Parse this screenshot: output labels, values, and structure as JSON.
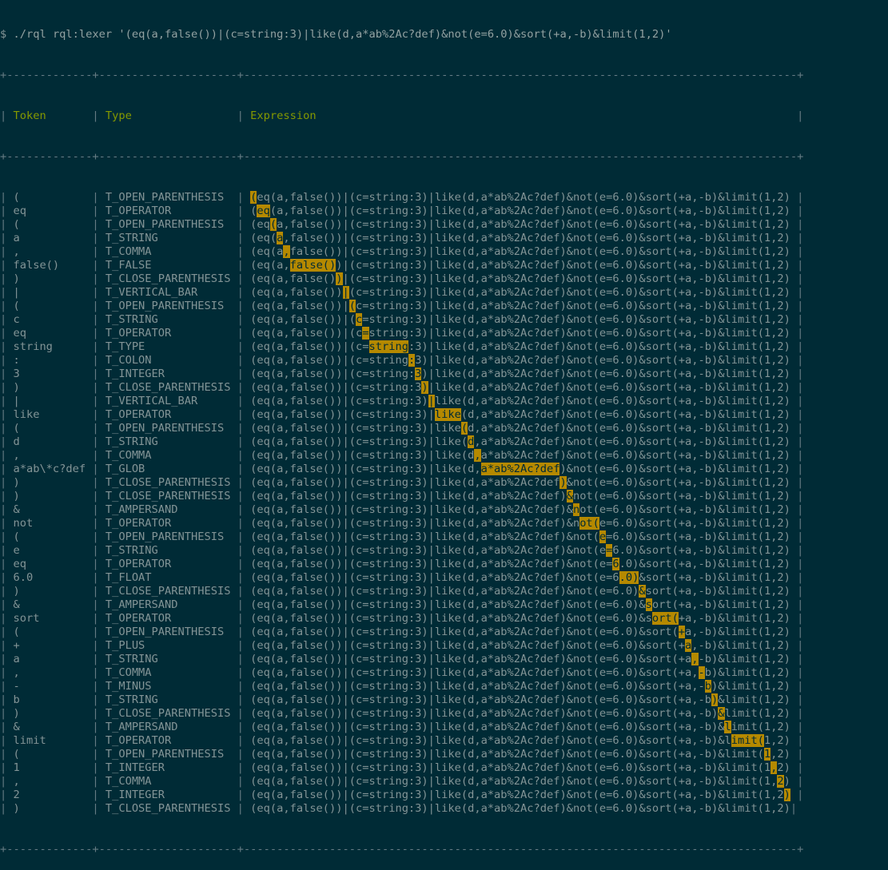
{
  "colors": {
    "background": "#002b36",
    "text": "#839496",
    "header": "#859900",
    "highlight_bg": "#b58900",
    "highlight_fg": "#002b36"
  },
  "prompt": "$",
  "command": "./rql rql:lexer '(eq(a,false())|(c=string:3)|like(d,a*ab%2Ac?def)&not(e=6.0)&sort(+a,-b)&limit(1,2)'",
  "expression": "(eq(a,false())|(c=string:3)|like(d,a*ab%2Ac?def)&not(e=6.0)&sort(+a,-b)&limit(1,2)",
  "headers": {
    "token": "Token",
    "type": "Type",
    "expression": "Expression"
  },
  "rows": [
    {
      "token": "(",
      "type": "T_OPEN_PARENTHESIS",
      "start": 0,
      "len": 1
    },
    {
      "token": "eq",
      "type": "T_OPERATOR",
      "start": 1,
      "len": 2
    },
    {
      "token": "(",
      "type": "T_OPEN_PARENTHESIS",
      "start": 3,
      "len": 1
    },
    {
      "token": "a",
      "type": "T_STRING",
      "start": 4,
      "len": 1
    },
    {
      "token": ",",
      "type": "T_COMMA",
      "start": 5,
      "len": 1
    },
    {
      "token": "false()",
      "type": "T_FALSE",
      "start": 6,
      "len": 7
    },
    {
      "token": ")",
      "type": "T_CLOSE_PARENTHESIS",
      "start": 13,
      "len": 1
    },
    {
      "token": "|",
      "type": "T_VERTICAL_BAR",
      "start": 14,
      "len": 1
    },
    {
      "token": "(",
      "type": "T_OPEN_PARENTHESIS",
      "start": 15,
      "len": 1
    },
    {
      "token": "c",
      "type": "T_STRING",
      "start": 16,
      "len": 1
    },
    {
      "token": "eq",
      "type": "T_OPERATOR",
      "start": 17,
      "len": 1
    },
    {
      "token": "string",
      "type": "T_TYPE",
      "start": 18,
      "len": 6
    },
    {
      "token": ":",
      "type": "T_COLON",
      "start": 24,
      "len": 1
    },
    {
      "token": "3",
      "type": "T_INTEGER",
      "start": 25,
      "len": 1
    },
    {
      "token": ")",
      "type": "T_CLOSE_PARENTHESIS",
      "start": 26,
      "len": 1
    },
    {
      "token": "|",
      "type": "T_VERTICAL_BAR",
      "start": 27,
      "len": 1
    },
    {
      "token": "like",
      "type": "T_OPERATOR",
      "start": 28,
      "len": 4
    },
    {
      "token": "(",
      "type": "T_OPEN_PARENTHESIS",
      "start": 32,
      "len": 1
    },
    {
      "token": "d",
      "type": "T_STRING",
      "start": 33,
      "len": 1
    },
    {
      "token": ",",
      "type": "T_COMMA",
      "start": 34,
      "len": 1
    },
    {
      "token": "a*ab\\*c?def",
      "type": "T_GLOB",
      "start": 35,
      "len": 12
    },
    {
      "token": ")",
      "type": "T_CLOSE_PARENTHESIS",
      "start": 47,
      "len": 1
    },
    {
      "token": ")",
      "type": "T_CLOSE_PARENTHESIS",
      "start": 48,
      "len": 1
    },
    {
      "token": "&",
      "type": "T_AMPERSAND",
      "start": 49,
      "len": 1
    },
    {
      "token": "not",
      "type": "T_OPERATOR",
      "start": 50,
      "len": 3
    },
    {
      "token": "(",
      "type": "T_OPEN_PARENTHESIS",
      "start": 53,
      "len": 1
    },
    {
      "token": "e",
      "type": "T_STRING",
      "start": 54,
      "len": 1
    },
    {
      "token": "eq",
      "type": "T_OPERATOR",
      "start": 55,
      "len": 1
    },
    {
      "token": "6.0",
      "type": "T_FLOAT",
      "start": 56,
      "len": 3
    },
    {
      "token": ")",
      "type": "T_CLOSE_PARENTHESIS",
      "start": 59,
      "len": 1
    },
    {
      "token": "&",
      "type": "T_AMPERSAND",
      "start": 60,
      "len": 1
    },
    {
      "token": "sort",
      "type": "T_OPERATOR",
      "start": 61,
      "len": 4
    },
    {
      "token": "(",
      "type": "T_OPEN_PARENTHESIS",
      "start": 65,
      "len": 1
    },
    {
      "token": "+",
      "type": "T_PLUS",
      "start": 66,
      "len": 1
    },
    {
      "token": "a",
      "type": "T_STRING",
      "start": 67,
      "len": 1
    },
    {
      "token": ",",
      "type": "T_COMMA",
      "start": 68,
      "len": 1
    },
    {
      "token": "-",
      "type": "T_MINUS",
      "start": 69,
      "len": 1
    },
    {
      "token": "b",
      "type": "T_STRING",
      "start": 70,
      "len": 1
    },
    {
      "token": ")",
      "type": "T_CLOSE_PARENTHESIS",
      "start": 71,
      "len": 1
    },
    {
      "token": "&",
      "type": "T_AMPERSAND",
      "start": 72,
      "len": 1
    },
    {
      "token": "limit",
      "type": "T_OPERATOR",
      "start": 73,
      "len": 5
    },
    {
      "token": "(",
      "type": "T_OPEN_PARENTHESIS",
      "start": 78,
      "len": 1
    },
    {
      "token": "1",
      "type": "T_INTEGER",
      "start": 79,
      "len": 1
    },
    {
      "token": ",",
      "type": "T_COMMA",
      "start": 80,
      "len": 1
    },
    {
      "token": "2",
      "type": "T_INTEGER",
      "start": 81,
      "len": 1
    },
    {
      "token": ")",
      "type": "T_CLOSE_PARENTHESIS",
      "start": 82,
      "len": 1
    }
  ]
}
